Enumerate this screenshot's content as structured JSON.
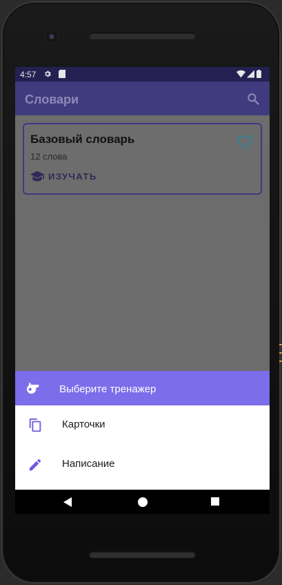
{
  "status_bar": {
    "time": "4:57",
    "icons": [
      "gear-icon",
      "sd-card-icon",
      "wifi-icon",
      "signal-icon",
      "battery-icon"
    ]
  },
  "app_bar": {
    "title": "Словари",
    "search_icon": "search-icon"
  },
  "dictionary_card": {
    "title": "Базовый словарь",
    "word_count": "12 слова",
    "study_label": "ИЗУЧАТЬ",
    "favorite_icon": "heart-outline-icon",
    "study_icon": "graduation-cap-icon"
  },
  "trainer_sheet": {
    "header": "Выберите тренажер",
    "header_icon": "whistle-icon",
    "options": [
      {
        "label": "Карточки",
        "icon": "copy-cards-icon"
      },
      {
        "label": "Написание",
        "icon": "pencil-icon"
      }
    ]
  },
  "navigation": [
    "back-icon",
    "home-icon",
    "recents-icon"
  ],
  "colors": {
    "status_bar": "#242052",
    "app_bar": "#403a7f",
    "sheet_header": "#7c6dea",
    "accent": "#6a5ae0",
    "scrim": "#6c6c6c"
  }
}
